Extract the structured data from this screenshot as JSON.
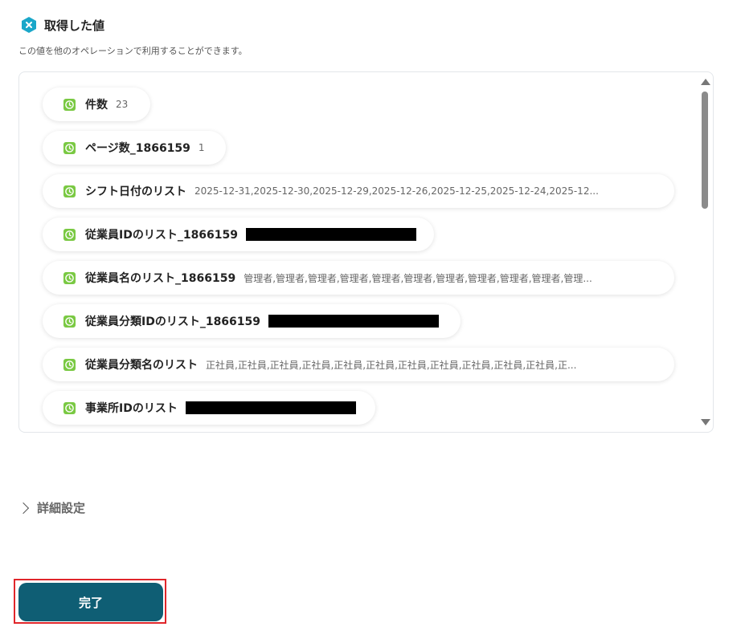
{
  "header": {
    "title": "取得した値",
    "subtitle": "この値を他のオペレーションで利用することができます。"
  },
  "items": [
    {
      "label": "件数",
      "value": "23",
      "redacted": false
    },
    {
      "label": "ページ数_1866159",
      "value": "1",
      "redacted": false
    },
    {
      "label": "シフト日付のリスト",
      "value": "2025-12-31,2025-12-30,2025-12-29,2025-12-26,2025-12-25,2025-12-24,2025-12...",
      "redacted": false
    },
    {
      "label": "従業員IDのリスト_1866159",
      "value": "",
      "redacted": true
    },
    {
      "label": "従業員名のリスト_1866159",
      "value": "管理者,管理者,管理者,管理者,管理者,管理者,管理者,管理者,管理者,管理者,管理...",
      "redacted": false
    },
    {
      "label": "従業員分類IDのリスト_1866159",
      "value": "",
      "redacted": true
    },
    {
      "label": "従業員分類名のリスト",
      "value": "正社員,正社員,正社員,正社員,正社員,正社員,正社員,正社員,正社員,正社員,正社員,正...",
      "redacted": false
    },
    {
      "label": "事業所IDのリスト",
      "value": "",
      "redacted": true
    }
  ],
  "details": {
    "label": "詳細設定"
  },
  "footer": {
    "done_label": "完了"
  },
  "colors": {
    "accent_hex": "#1aa7c9",
    "clock_green": "#7ac943",
    "button_bg": "#0f5e74",
    "highlight_border": "#e0262a"
  },
  "icons": {
    "header": "hexagon-x-icon",
    "item": "clock-icon",
    "details": "chevron-right-icon"
  }
}
